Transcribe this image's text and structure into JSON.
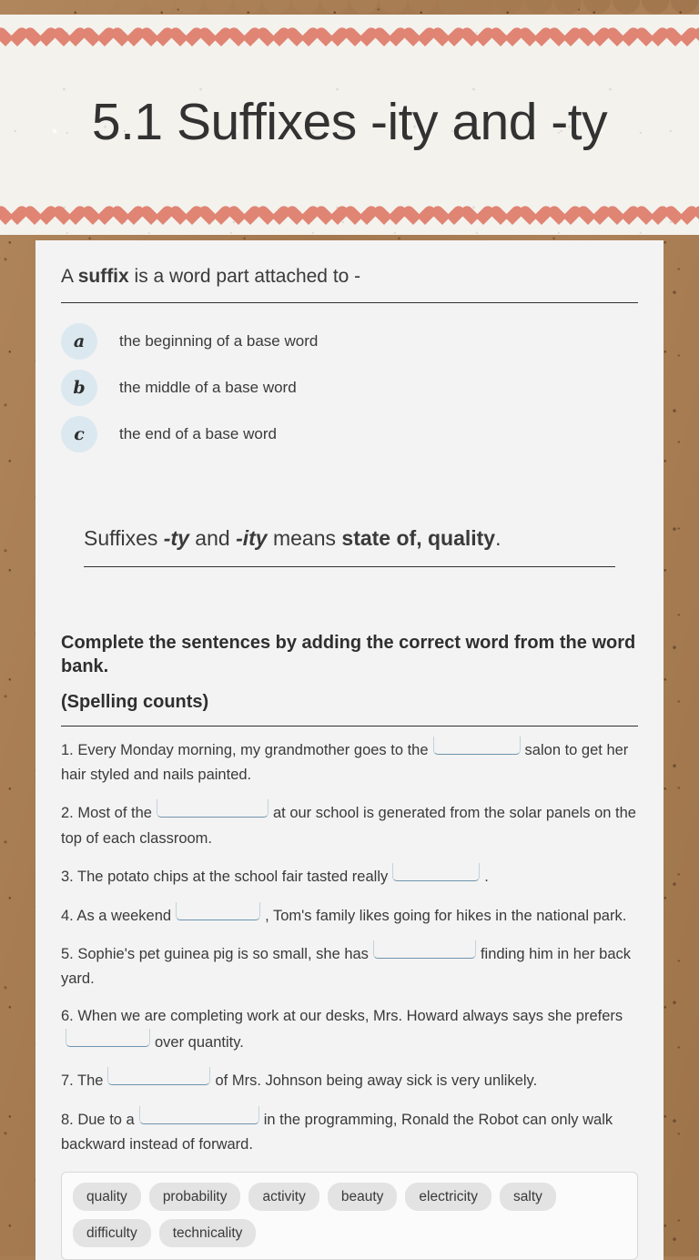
{
  "title": "5.1 Suffixes -ity and -ty",
  "theme": {
    "heart_color": "#e08474",
    "kraft_color": "#a87d54",
    "banner_color": "#f4f2ed",
    "card_color": "#f3f3f3",
    "badge_color": "#dbe8f0",
    "blank_line_color": "#6e94ae",
    "chip_color": "#e3e3e3"
  },
  "question": {
    "prompt_prefix": "A ",
    "prompt_bold": "suffix",
    "prompt_suffix": " is a word part attached to -",
    "choices": [
      {
        "letter": "a",
        "text": "the beginning of a base word"
      },
      {
        "letter": "b",
        "text": "the middle of a base word"
      },
      {
        "letter": "c",
        "text": "the end of a base word"
      }
    ]
  },
  "rule": {
    "part1": "Suffixes ",
    "suffix1": "-ty",
    "part2": " and ",
    "suffix2": "-ity",
    "part3": " means ",
    "meaning": "state of, quality",
    "period": "."
  },
  "instructions": {
    "main": "Complete the sentences by adding the correct word from the word bank.",
    "sub": "(Spelling counts)"
  },
  "sentences": [
    {
      "before": "1. Every Monday morning, my grandmother goes to the",
      "blank_width": 96,
      "after": "salon to get her hair styled and nails painted."
    },
    {
      "before": "2. Most of the",
      "blank_width": 123,
      "after": "at our school is generated from the solar panels on the top of each classroom."
    },
    {
      "before": "3. The potato chips at the school fair tasted really",
      "blank_width": 96,
      "after": "."
    },
    {
      "before": "4. As a weekend",
      "blank_width": 93,
      "after": ", Tom's family likes going for hikes in the national park."
    },
    {
      "before": "5. Sophie's pet guinea pig is so small, she has",
      "blank_width": 113,
      "after": "finding him in her back yard."
    },
    {
      "before": "6. When we are completing work at our desks, Mrs. Howard always says she prefers",
      "blank_width": 93,
      "after": "over quantity."
    },
    {
      "before": "7. The",
      "blank_width": 113,
      "after": "of Mrs. Johnson being away sick is very unlikely."
    },
    {
      "before": "8. Due to a",
      "blank_width": 132,
      "after": "in the programming, Ronald the Robot can only walk backward instead of forward."
    }
  ],
  "word_bank": [
    "quality",
    "probability",
    "activity",
    "beauty",
    "electricity",
    "salty",
    "difficulty",
    "technicality"
  ]
}
